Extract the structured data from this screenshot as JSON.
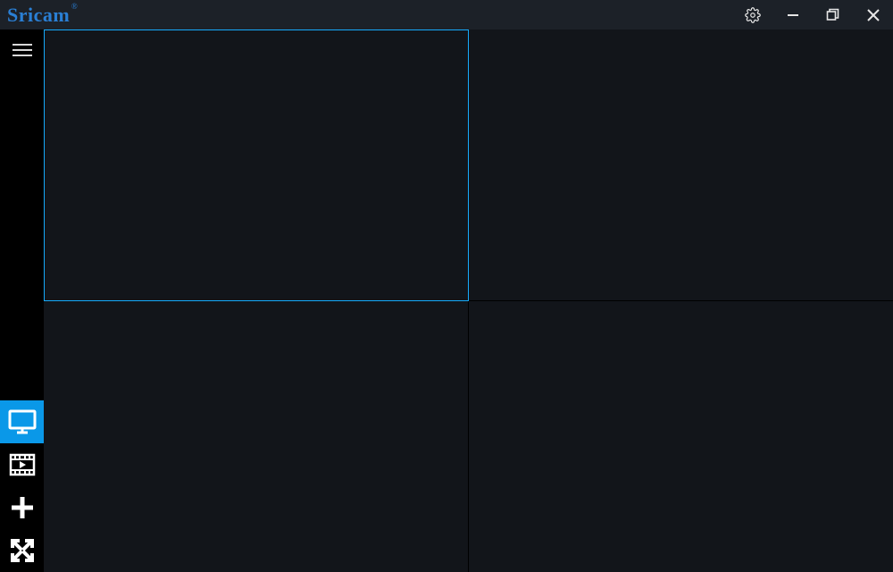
{
  "app": {
    "brand": "Sricam",
    "brand_reg": "®"
  },
  "window_controls": {
    "settings": "settings",
    "minimize": "minimize",
    "maximize": "maximize",
    "close": "close"
  },
  "sidebar": {
    "hamburger": "menu",
    "live_view": "live-view",
    "playback": "playback",
    "add_device": "add-device",
    "fullscreen": "fullscreen",
    "active": "live-view"
  },
  "grid": {
    "layout": "2x2",
    "cells": [
      {
        "id": 1,
        "selected": true
      },
      {
        "id": 2,
        "selected": false
      },
      {
        "id": 3,
        "selected": false
      },
      {
        "id": 4,
        "selected": false
      }
    ]
  }
}
